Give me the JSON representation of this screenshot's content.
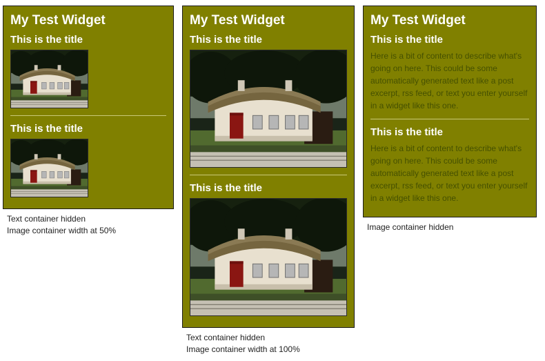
{
  "widget1": {
    "header": "My Test Widget",
    "item1_title": "This is the title",
    "item2_title": "This is the title",
    "caption_line1": "Text container hidden",
    "caption_line2": "Image container width at 50%"
  },
  "widget2": {
    "header": "My Test Widget",
    "item1_title": "This is the title",
    "item2_title": "This is the title",
    "caption_line1": "Text container hidden",
    "caption_line2": "Image container width at 100%"
  },
  "widget3": {
    "header": "My Test Widget",
    "item1_title": "This is the title",
    "item1_body": "Here is a bit of content to describe what's going on here. This could be some automatically generated text like a post excerpt, rss feed, or text you enter yourself in a widget like this one.",
    "item2_title": "This is the title",
    "item2_body": "Here is a bit of content to describe what's going on here. This could be some automatically generated text like a post excerpt, rss feed, or text you enter yourself in a widget like this one.",
    "caption_line1": "Image container hidden"
  }
}
